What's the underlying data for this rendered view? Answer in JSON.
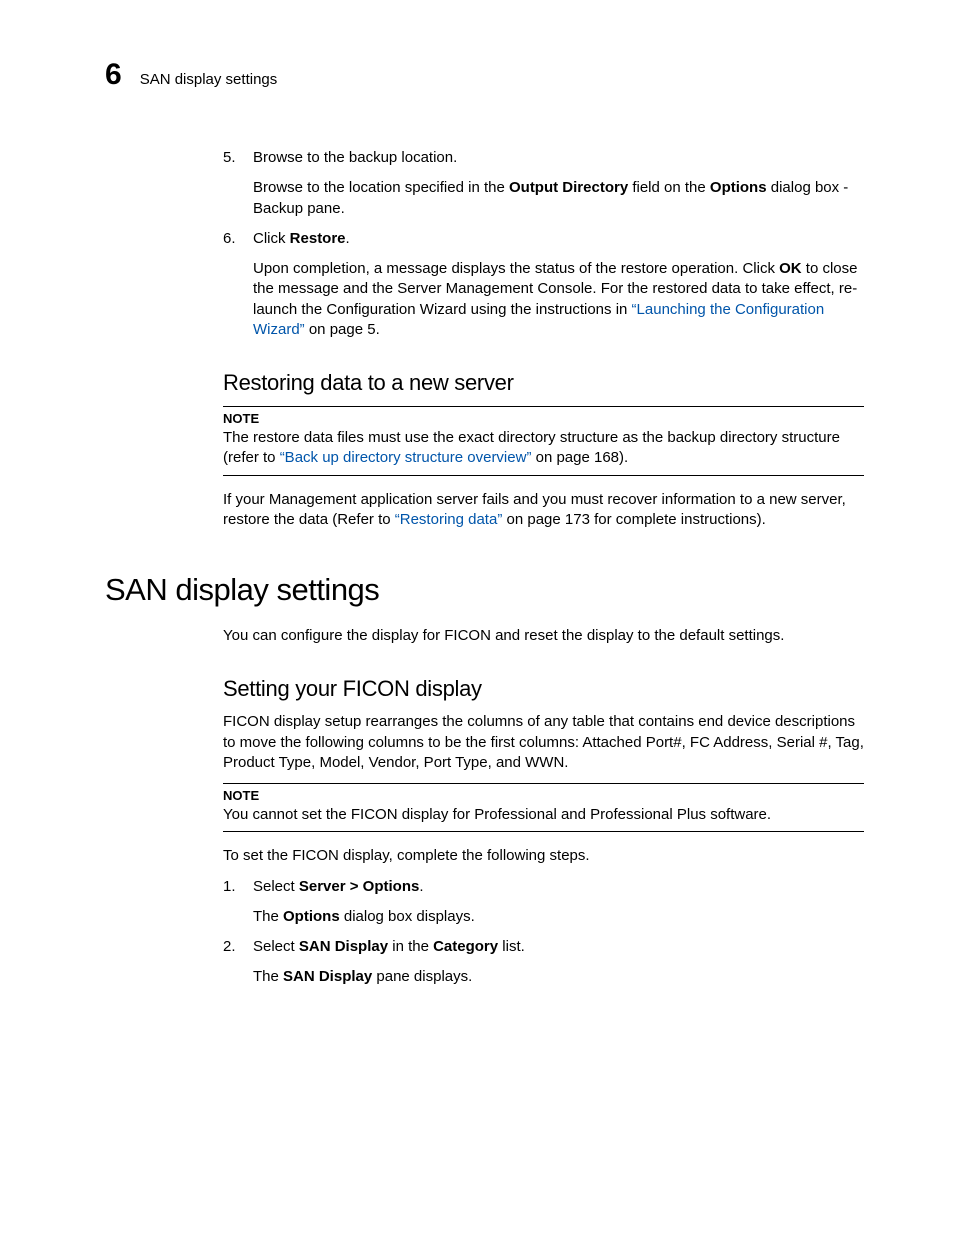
{
  "header": {
    "chapter_number": "6",
    "running_title": "SAN display settings"
  },
  "steps_a": [
    {
      "num": "5.",
      "text": "Browse to the backup location.",
      "sub_pre": "Browse to the location specified in the ",
      "sub_b1": "Output Directory",
      "sub_mid": " field on the ",
      "sub_b2": "Options",
      "sub_post": " dialog box - Backup pane."
    },
    {
      "num": "6.",
      "text_pre": "Click ",
      "text_b": "Restore",
      "text_post": ".",
      "sub_pre": "Upon completion, a message displays the status of the restore operation. Click ",
      "sub_b1": "OK",
      "sub_mid": " to close the message and the Server Management Console. For the restored data to take effect, re-launch the Configuration Wizard using the instructions in ",
      "sub_link": "“Launching the Configuration Wizard”",
      "sub_post": " on page 5."
    }
  ],
  "restoring_h2": "Restoring data to a new server",
  "note1": {
    "label": "NOTE",
    "pre": "The restore data files must use the exact directory structure as the backup directory structure (refer to ",
    "link": "“Back up directory structure overview”",
    "post": " on page 168)."
  },
  "restoring_para": {
    "pre": "If your Management application server fails and you must recover information to a new server, restore the data (Refer to ",
    "link": "“Restoring data”",
    "post": " on page 173 for complete instructions)."
  },
  "main_h1": "SAN display settings",
  "main_intro": "You can configure the display for FICON and reset the display to the default settings.",
  "ficon_h2": "Setting your FICON display",
  "ficon_para": "FICON display setup rearranges the columns of any table that contains end device descriptions to move the following columns to be the first columns: Attached Port#, FC Address, Serial #, Tag, Product Type, Model, Vendor, Port Type, and WWN.",
  "note2": {
    "label": "NOTE",
    "text": "You cannot set the FICON display for Professional and Professional Plus software."
  },
  "ficon_lead": "To set the FICON display, complete the following steps.",
  "steps_b": [
    {
      "num": "1.",
      "pre": "Select ",
      "b": "Server > Options",
      "post": ".",
      "sub_pre": "The ",
      "sub_b": "Options",
      "sub_post": " dialog box displays."
    },
    {
      "num": "2.",
      "pre": "Select ",
      "b": "SAN Display",
      "mid": " in the ",
      "b2": "Category",
      "post": " list.",
      "sub_pre": "The ",
      "sub_b": "SAN Display",
      "sub_post": " pane displays."
    }
  ]
}
